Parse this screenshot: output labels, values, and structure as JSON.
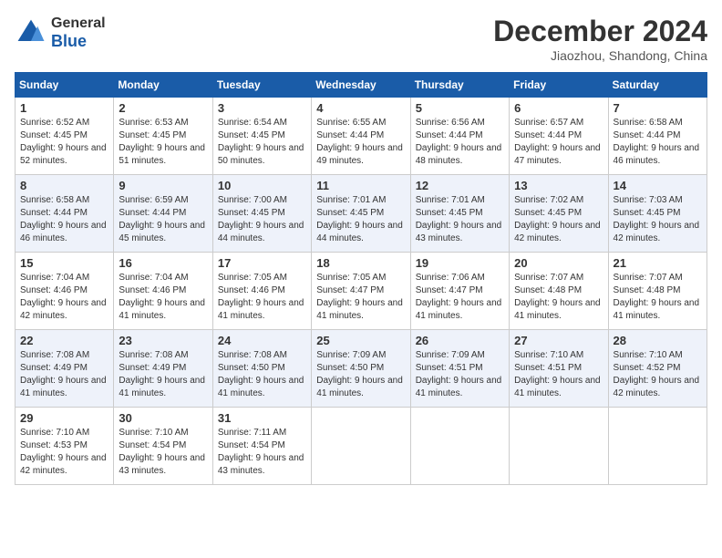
{
  "header": {
    "logo_general": "General",
    "logo_blue": "Blue",
    "month_title": "December 2024",
    "location": "Jiaozhou, Shandong, China"
  },
  "weekdays": [
    "Sunday",
    "Monday",
    "Tuesday",
    "Wednesday",
    "Thursday",
    "Friday",
    "Saturday"
  ],
  "weeks": [
    [
      {
        "day": "1",
        "sunrise": "6:52 AM",
        "sunset": "4:45 PM",
        "daylight": "9 hours and 52 minutes."
      },
      {
        "day": "2",
        "sunrise": "6:53 AM",
        "sunset": "4:45 PM",
        "daylight": "9 hours and 51 minutes."
      },
      {
        "day": "3",
        "sunrise": "6:54 AM",
        "sunset": "4:45 PM",
        "daylight": "9 hours and 50 minutes."
      },
      {
        "day": "4",
        "sunrise": "6:55 AM",
        "sunset": "4:44 PM",
        "daylight": "9 hours and 49 minutes."
      },
      {
        "day": "5",
        "sunrise": "6:56 AM",
        "sunset": "4:44 PM",
        "daylight": "9 hours and 48 minutes."
      },
      {
        "day": "6",
        "sunrise": "6:57 AM",
        "sunset": "4:44 PM",
        "daylight": "9 hours and 47 minutes."
      },
      {
        "day": "7",
        "sunrise": "6:58 AM",
        "sunset": "4:44 PM",
        "daylight": "9 hours and 46 minutes."
      }
    ],
    [
      {
        "day": "8",
        "sunrise": "6:58 AM",
        "sunset": "4:44 PM",
        "daylight": "9 hours and 46 minutes."
      },
      {
        "day": "9",
        "sunrise": "6:59 AM",
        "sunset": "4:44 PM",
        "daylight": "9 hours and 45 minutes."
      },
      {
        "day": "10",
        "sunrise": "7:00 AM",
        "sunset": "4:45 PM",
        "daylight": "9 hours and 44 minutes."
      },
      {
        "day": "11",
        "sunrise": "7:01 AM",
        "sunset": "4:45 PM",
        "daylight": "9 hours and 44 minutes."
      },
      {
        "day": "12",
        "sunrise": "7:01 AM",
        "sunset": "4:45 PM",
        "daylight": "9 hours and 43 minutes."
      },
      {
        "day": "13",
        "sunrise": "7:02 AM",
        "sunset": "4:45 PM",
        "daylight": "9 hours and 42 minutes."
      },
      {
        "day": "14",
        "sunrise": "7:03 AM",
        "sunset": "4:45 PM",
        "daylight": "9 hours and 42 minutes."
      }
    ],
    [
      {
        "day": "15",
        "sunrise": "7:04 AM",
        "sunset": "4:46 PM",
        "daylight": "9 hours and 42 minutes."
      },
      {
        "day": "16",
        "sunrise": "7:04 AM",
        "sunset": "4:46 PM",
        "daylight": "9 hours and 41 minutes."
      },
      {
        "day": "17",
        "sunrise": "7:05 AM",
        "sunset": "4:46 PM",
        "daylight": "9 hours and 41 minutes."
      },
      {
        "day": "18",
        "sunrise": "7:05 AM",
        "sunset": "4:47 PM",
        "daylight": "9 hours and 41 minutes."
      },
      {
        "day": "19",
        "sunrise": "7:06 AM",
        "sunset": "4:47 PM",
        "daylight": "9 hours and 41 minutes."
      },
      {
        "day": "20",
        "sunrise": "7:07 AM",
        "sunset": "4:48 PM",
        "daylight": "9 hours and 41 minutes."
      },
      {
        "day": "21",
        "sunrise": "7:07 AM",
        "sunset": "4:48 PM",
        "daylight": "9 hours and 41 minutes."
      }
    ],
    [
      {
        "day": "22",
        "sunrise": "7:08 AM",
        "sunset": "4:49 PM",
        "daylight": "9 hours and 41 minutes."
      },
      {
        "day": "23",
        "sunrise": "7:08 AM",
        "sunset": "4:49 PM",
        "daylight": "9 hours and 41 minutes."
      },
      {
        "day": "24",
        "sunrise": "7:08 AM",
        "sunset": "4:50 PM",
        "daylight": "9 hours and 41 minutes."
      },
      {
        "day": "25",
        "sunrise": "7:09 AM",
        "sunset": "4:50 PM",
        "daylight": "9 hours and 41 minutes."
      },
      {
        "day": "26",
        "sunrise": "7:09 AM",
        "sunset": "4:51 PM",
        "daylight": "9 hours and 41 minutes."
      },
      {
        "day": "27",
        "sunrise": "7:10 AM",
        "sunset": "4:51 PM",
        "daylight": "9 hours and 41 minutes."
      },
      {
        "day": "28",
        "sunrise": "7:10 AM",
        "sunset": "4:52 PM",
        "daylight": "9 hours and 42 minutes."
      }
    ],
    [
      {
        "day": "29",
        "sunrise": "7:10 AM",
        "sunset": "4:53 PM",
        "daylight": "9 hours and 42 minutes."
      },
      {
        "day": "30",
        "sunrise": "7:10 AM",
        "sunset": "4:54 PM",
        "daylight": "9 hours and 43 minutes."
      },
      {
        "day": "31",
        "sunrise": "7:11 AM",
        "sunset": "4:54 PM",
        "daylight": "9 hours and 43 minutes."
      },
      null,
      null,
      null,
      null
    ]
  ]
}
